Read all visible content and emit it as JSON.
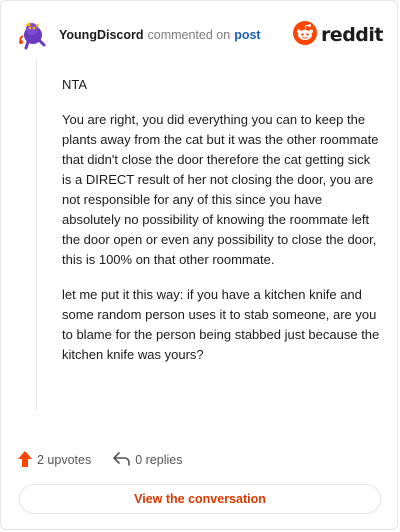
{
  "header": {
    "username": "YoungDiscord",
    "action_text": "commented on",
    "post_link": "post",
    "brand": "reddit"
  },
  "comment": {
    "paragraphs": [
      "NTA",
      "You are right, you did everything you can to keep the plants away from the cat but it was the other roommate that didn't close the door therefore the cat getting sick is a DIRECT result of her not closing the door, you are not responsible for any of this since you have absolutely no possibility of knowing the roommate left the door open or even any possibility to close the door, this is 100% on that other roommate.",
      "let me put it this way: if you have a kitchen knife and some random person uses it to stab someone, are you to blame for the person being stabbed just because the kitchen knife was yours?"
    ]
  },
  "actions": {
    "upvotes": "2 upvotes",
    "replies": "0 replies"
  },
  "view_conversation": "View the conversation",
  "colors": {
    "accent": "#d93900",
    "link": "#1a5fb4",
    "upvote": "#ff4500"
  },
  "icons": {
    "avatar": "snoo-avatar-icon",
    "brand": "reddit-snoo-icon",
    "upvote": "upvote-arrow-icon",
    "reply": "reply-arrow-icon"
  }
}
